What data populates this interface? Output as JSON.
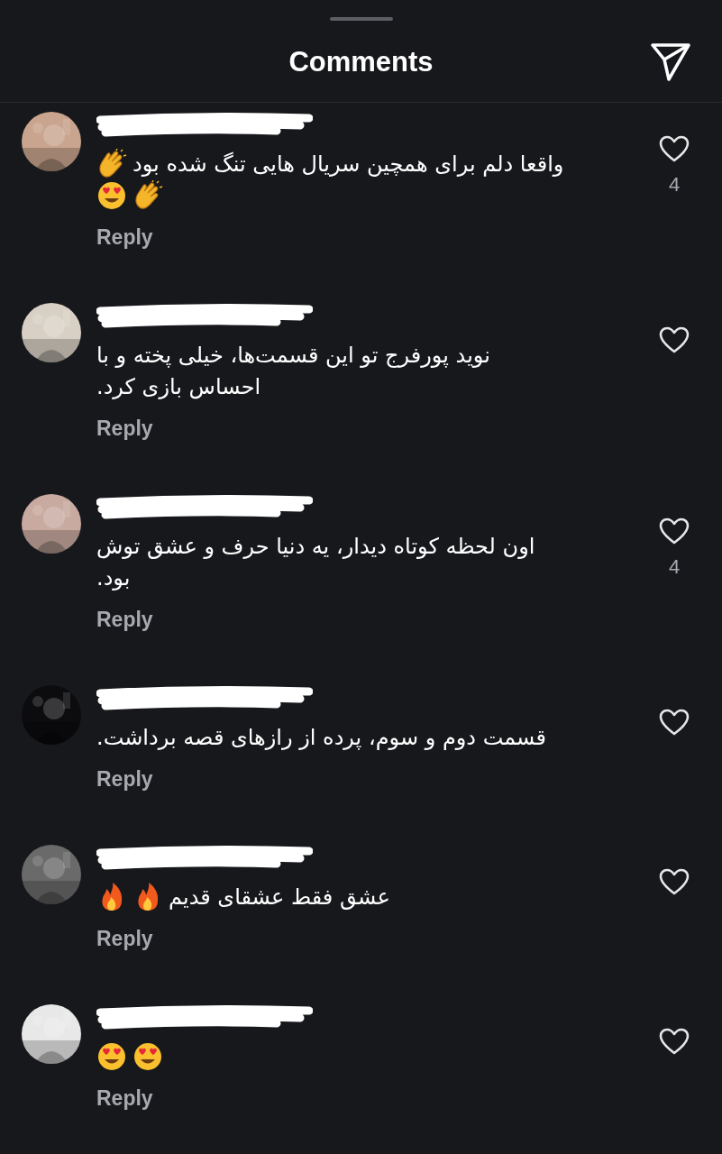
{
  "header": {
    "title": "Comments"
  },
  "comments": [
    {
      "avatar": {
        "kind": "picture"
      },
      "lines": [
        {
          "text": "واقعا دلم برای همچین سریال هایی تنگ شده بود",
          "emoji": [
            {
              "kind": "clap"
            }
          ]
        },
        {
          "emoji": [
            {
              "kind": "clap"
            },
            {
              "kind": "heart_eyes"
            }
          ]
        }
      ],
      "reply": "Reply",
      "likes": "4"
    },
    {
      "avatar": {
        "kind": "picture"
      },
      "lines": [
        {
          "text": "نوید پورفرج تو این قسمت‌ها، خیلی پخته و با"
        },
        {
          "text": "احساس بازی کرد."
        }
      ],
      "reply": "Reply"
    },
    {
      "avatar": {
        "kind": "picture"
      },
      "lines": [
        {
          "text": "اون لحظه کوتاه دیدار، یه دنیا حرف و عشق توش"
        },
        {
          "text": "بود."
        }
      ],
      "reply": "Reply",
      "likes": "4"
    },
    {
      "avatar": {
        "kind": "picture"
      },
      "lines": [
        {
          "text": "قسمت دوم و سوم، پرده از رازهای قصه برداشت."
        }
      ],
      "reply": "Reply"
    },
    {
      "avatar": {
        "kind": "picture"
      },
      "lines": [
        {
          "text": "عشق فقط عشقای قدیم",
          "emoji": [
            {
              "kind": "fire"
            },
            {
              "kind": "fire"
            }
          ]
        }
      ],
      "reply": "Reply"
    },
    {
      "avatar": {
        "kind": "picture"
      },
      "lines": [
        {
          "emoji": [
            {
              "kind": "heart_eyes"
            },
            {
              "kind": "heart_eyes"
            }
          ]
        }
      ],
      "reply": "Reply"
    }
  ]
}
